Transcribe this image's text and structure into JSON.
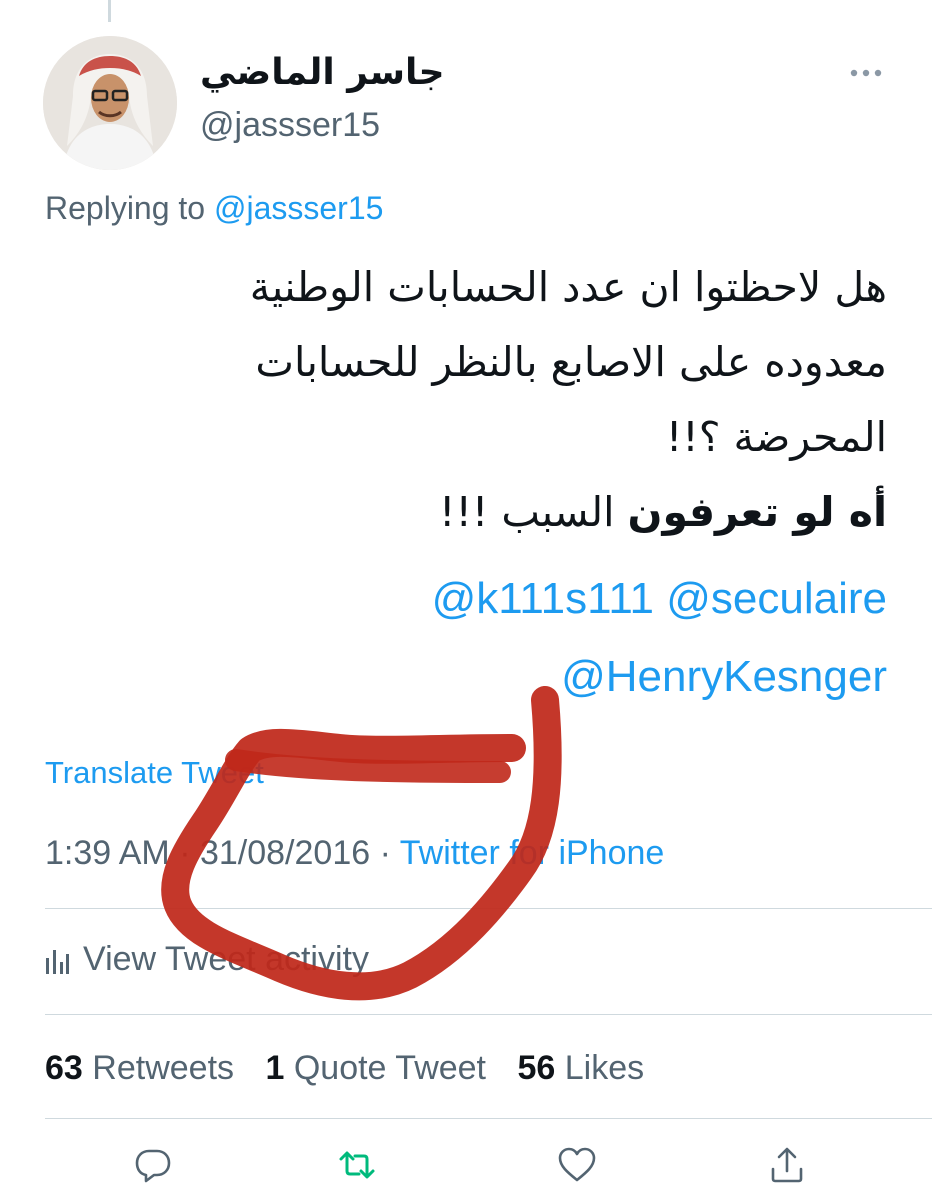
{
  "user": {
    "display_name": "جاسر الماضي",
    "handle": "@jassser15",
    "avatar_icon": "person-avatar"
  },
  "reply": {
    "prefix": "Replying to",
    "to": "@jassser15"
  },
  "tweet": {
    "lines": [
      "هل لاحظتوا ان عدد الحسابات الوطنية",
      "معدوده على الاصابع بالنظر للحسابات",
      "المحرضة ؟!!"
    ],
    "line4_bold": "أه لو تعرفون",
    "line4_rest": " السبب !!!",
    "mentions": [
      "@k111s111",
      "@seculaire",
      "@HenryKesnger"
    ]
  },
  "translate_label": "Translate Tweet",
  "meta": {
    "time": "1:39 AM",
    "date": "31/08/2016",
    "source": "Twitter for iPhone",
    "separator": " · "
  },
  "activity_label": "View Tweet activity",
  "stats": {
    "retweets_count": "63",
    "retweets_label": "Retweets",
    "quotes_count": "1",
    "quotes_label": "Quote Tweet",
    "likes_count": "56",
    "likes_label": "Likes"
  },
  "actions": [
    "reply-icon",
    "retweet-icon",
    "like-icon",
    "share-icon"
  ],
  "colors": {
    "accent": "#1d9bf0",
    "retweet_green": "#00ba7c",
    "secondary_text": "#536471",
    "annotation_red": "#c0281a"
  }
}
